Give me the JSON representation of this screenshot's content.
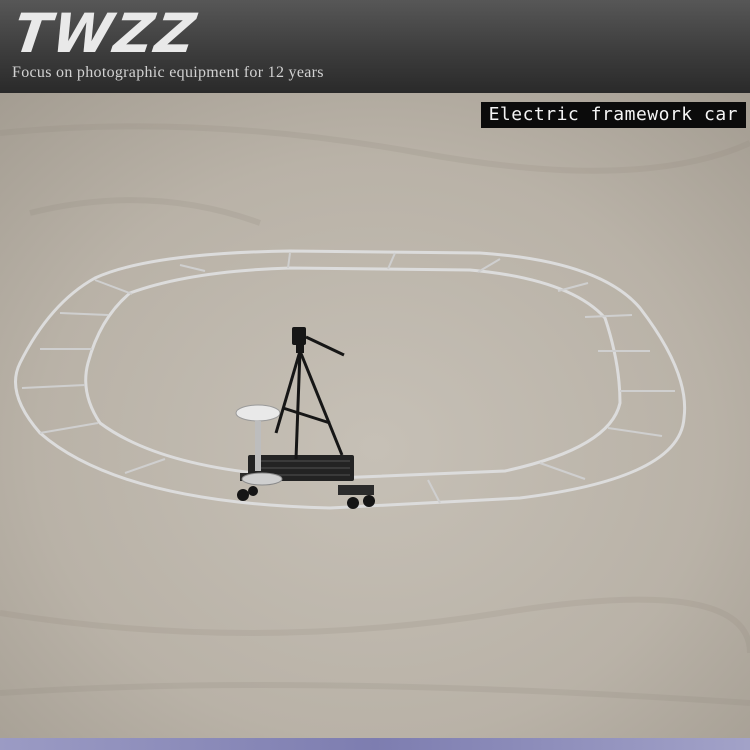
{
  "brand": {
    "logo_text": "TWZZ",
    "tagline": "Focus on photographic equipment for 12 years"
  },
  "caption": "Electric framework car",
  "photo": {
    "subject": "oval track dolly with tripod camera on concrete floor",
    "colors": {
      "floor": "#bdb6ab",
      "rail": "#d8d8d8",
      "dolly": "#1e1e1e"
    }
  }
}
